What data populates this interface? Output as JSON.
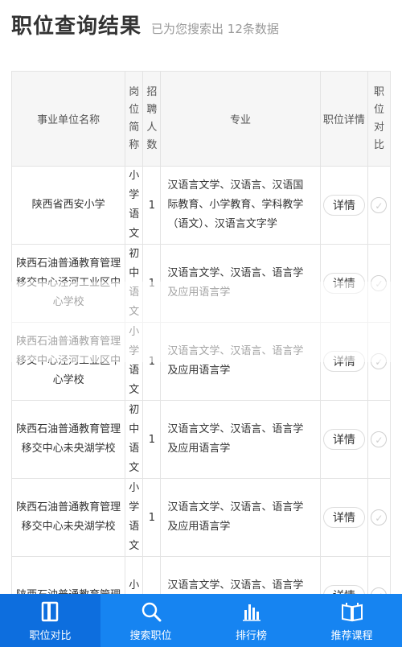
{
  "header": {
    "title": "职位查询结果",
    "subtitle": "已为您搜索出 12条数据"
  },
  "table": {
    "columns": {
      "unit": "事业单位名称",
      "post": "岗位简称",
      "num": "招聘人数",
      "major": "专业",
      "detail": "职位详情",
      "compare": "职位对比"
    },
    "detail_label": "详情",
    "rows": [
      {
        "unit": "陕西省西安小学",
        "post": "小学语文",
        "num": "1",
        "major": "汉语言文学、汉语言、汉语国际教育、小学教育、学科教学（语文）、汉语言文字学"
      },
      {
        "unit": "陕西石油普通教育管理移交中心泾河工业区中心学校",
        "post": "初中语文",
        "num": "1",
        "major": "汉语言文学、汉语言、语言学及应用语言学"
      },
      {
        "unit": "陕西石油普通教育管理移交中心泾河工业区中心学校",
        "post": "小学语文",
        "num": "1",
        "major": "汉语言文学、汉语言、语言学及应用语言学"
      },
      {
        "unit": "陕西石油普通教育管理移交中心未央湖学校",
        "post": "初中语文",
        "num": "1",
        "major": "汉语言文学、汉语言、语言学及应用语言学"
      },
      {
        "unit": "陕西石油普通教育管理移交中心未央湖学校",
        "post": "小学语文",
        "num": "1",
        "major": "汉语言文学、汉语言、语言学及应用语言学"
      },
      {
        "unit": "陕西石油普通教育管理",
        "post": "小学",
        "num": "",
        "major": "汉语言文学、汉语言、语言学及"
      }
    ]
  },
  "tabbar": {
    "items": [
      {
        "label": "职位对比",
        "icon": "book-icon",
        "active": true
      },
      {
        "label": "搜索职位",
        "icon": "search-icon",
        "active": false
      },
      {
        "label": "排行榜",
        "icon": "bar-chart-icon",
        "active": false
      },
      {
        "label": "推荐课程",
        "icon": "open-book-icon",
        "active": false
      }
    ]
  },
  "colors": {
    "tabbar": "#1684f1",
    "tab_active": "#0d6ede"
  }
}
